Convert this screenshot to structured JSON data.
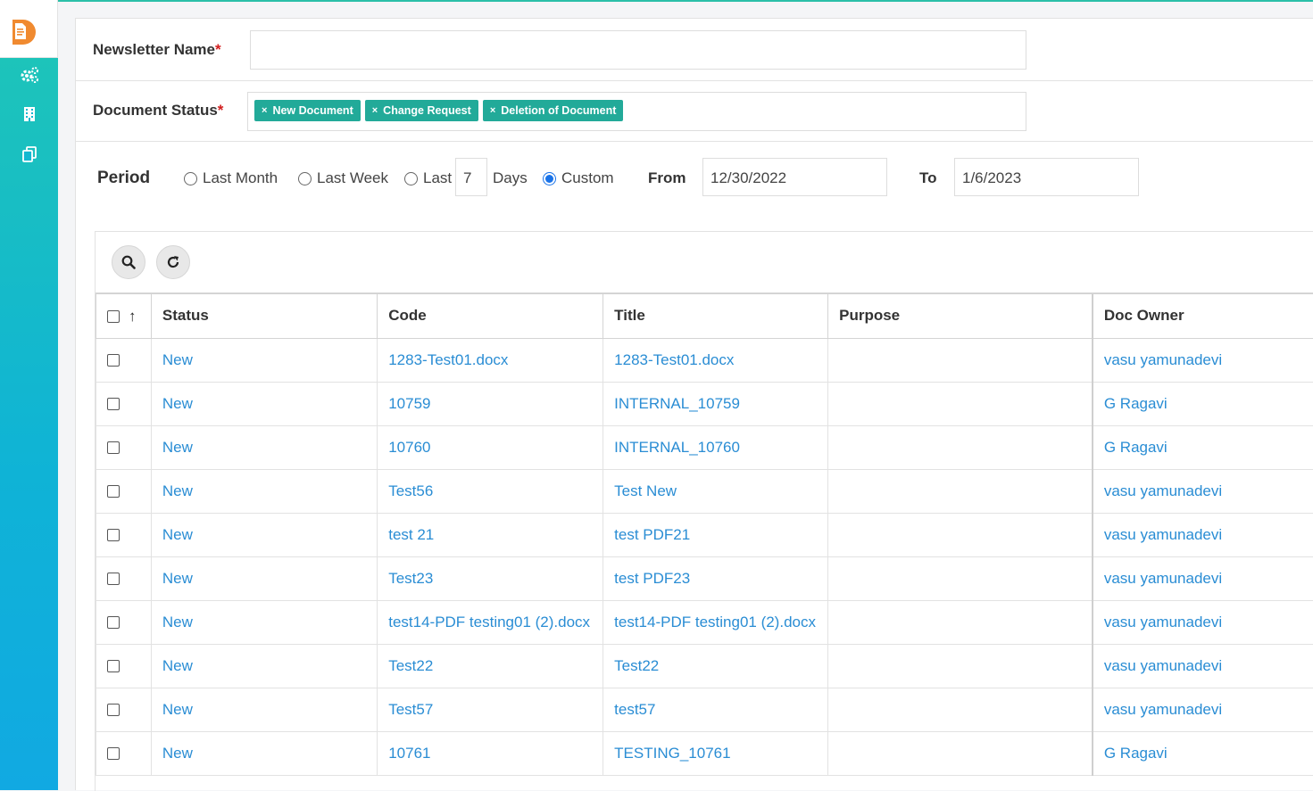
{
  "sidebar": {
    "logo_icon": "document-logo-icon",
    "items": [
      {
        "icon": "settings-gears-icon"
      },
      {
        "icon": "building-icon"
      },
      {
        "icon": "copy-documents-icon"
      }
    ]
  },
  "form": {
    "newsletter_label": "Newsletter Name",
    "required_mark": "*",
    "newsletter_value": "",
    "status_label": "Document Status",
    "status_tags": [
      "New Document",
      "Change Request",
      "Deletion of Document"
    ],
    "tag_remove": "×"
  },
  "period": {
    "label": "Period",
    "options": {
      "last_month": "Last Month",
      "last_week": "Last Week",
      "last": "Last",
      "days_value": "7",
      "days": "Days",
      "custom": "Custom"
    },
    "selected": "Custom",
    "from_label": "From",
    "from_value": "12/30/2022",
    "to_label": "To",
    "to_value": "1/6/2023"
  },
  "table": {
    "sort_arrow": "↑",
    "columns": [
      "Status",
      "Code",
      "Title",
      "Purpose",
      "Doc Owner"
    ],
    "rows": [
      {
        "status": "New",
        "code": "1283-Test01.docx",
        "title": "1283-Test01.docx",
        "purpose": "",
        "owner": "vasu yamunadevi"
      },
      {
        "status": "New",
        "code": "10759",
        "title": "INTERNAL_10759",
        "purpose": "",
        "owner": "G Ragavi"
      },
      {
        "status": "New",
        "code": "10760",
        "title": "INTERNAL_10760",
        "purpose": "",
        "owner": "G Ragavi"
      },
      {
        "status": "New",
        "code": "Test56",
        "title": "Test New",
        "purpose": "",
        "owner": "vasu yamunadevi"
      },
      {
        "status": "New",
        "code": "test 21",
        "title": "test PDF21",
        "purpose": "",
        "owner": "vasu yamunadevi"
      },
      {
        "status": "New",
        "code": "Test23",
        "title": "test PDF23",
        "purpose": "",
        "owner": "vasu yamunadevi"
      },
      {
        "status": "New",
        "code": "test14-PDF testing01 (2).docx",
        "title": "test14-PDF testing01 (2).docx",
        "purpose": "",
        "owner": "vasu yamunadevi"
      },
      {
        "status": "New",
        "code": "Test22",
        "title": "Test22",
        "purpose": "",
        "owner": "vasu yamunadevi"
      },
      {
        "status": "New",
        "code": "Test57",
        "title": "test57",
        "purpose": "",
        "owner": "vasu yamunadevi"
      },
      {
        "status": "New",
        "code": "10761",
        "title": "TESTING_10761",
        "purpose": "",
        "owner": "G Ragavi"
      }
    ]
  },
  "colors": {
    "accent": "#22aa99",
    "link": "#2a8dd4",
    "required": "#d21d1d"
  }
}
